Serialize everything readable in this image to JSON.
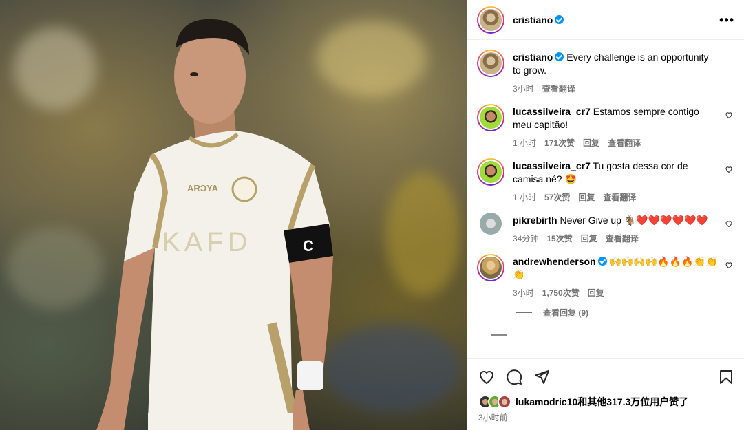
{
  "post": {
    "username": "cristiano",
    "header_more": "•••"
  },
  "caption": {
    "username": "cristiano",
    "text": "Every challenge is an opportunity to grow.",
    "time": "3小时",
    "translate": "查看翻译"
  },
  "comments": [
    {
      "username": "lucassilveira_cr7",
      "text": "Estamos sempre contigo meu capitão!",
      "time": "1 小时",
      "likes": "171次赞",
      "reply": "回复",
      "translate": "查看翻译"
    },
    {
      "username": "lucassilveira_cr7",
      "text": "Tu gosta dessa cor de camisa né? 🤩",
      "time": "1 小时",
      "likes": "57次赞",
      "reply": "回复",
      "translate": "查看翻译"
    },
    {
      "username": "pikrebirth",
      "text": "Never Give up 🐐❤️❤️❤️❤️❤️❤️",
      "time": "34分钟",
      "likes": "15次赞",
      "reply": "回复",
      "translate": "查看翻译"
    },
    {
      "username": "andrewhenderson",
      "text": "🙌🙌🙌🙌🔥🔥🔥👏👏👏",
      "time": "3小时",
      "likes": "1,750次赞",
      "reply": "回复"
    }
  ],
  "view_replies": "查看回复 (9)",
  "likes_summary": "lukamodric10和其他317.3万位用户赞了",
  "post_time": "3小时前",
  "icons": {
    "like": "heart-icon",
    "comment": "comment-icon",
    "share": "share-icon",
    "save": "bookmark-icon",
    "more": "more-icon"
  },
  "colors": {
    "verified": "#0095f6",
    "meta_text": "#737373",
    "divider": "#efefef"
  }
}
